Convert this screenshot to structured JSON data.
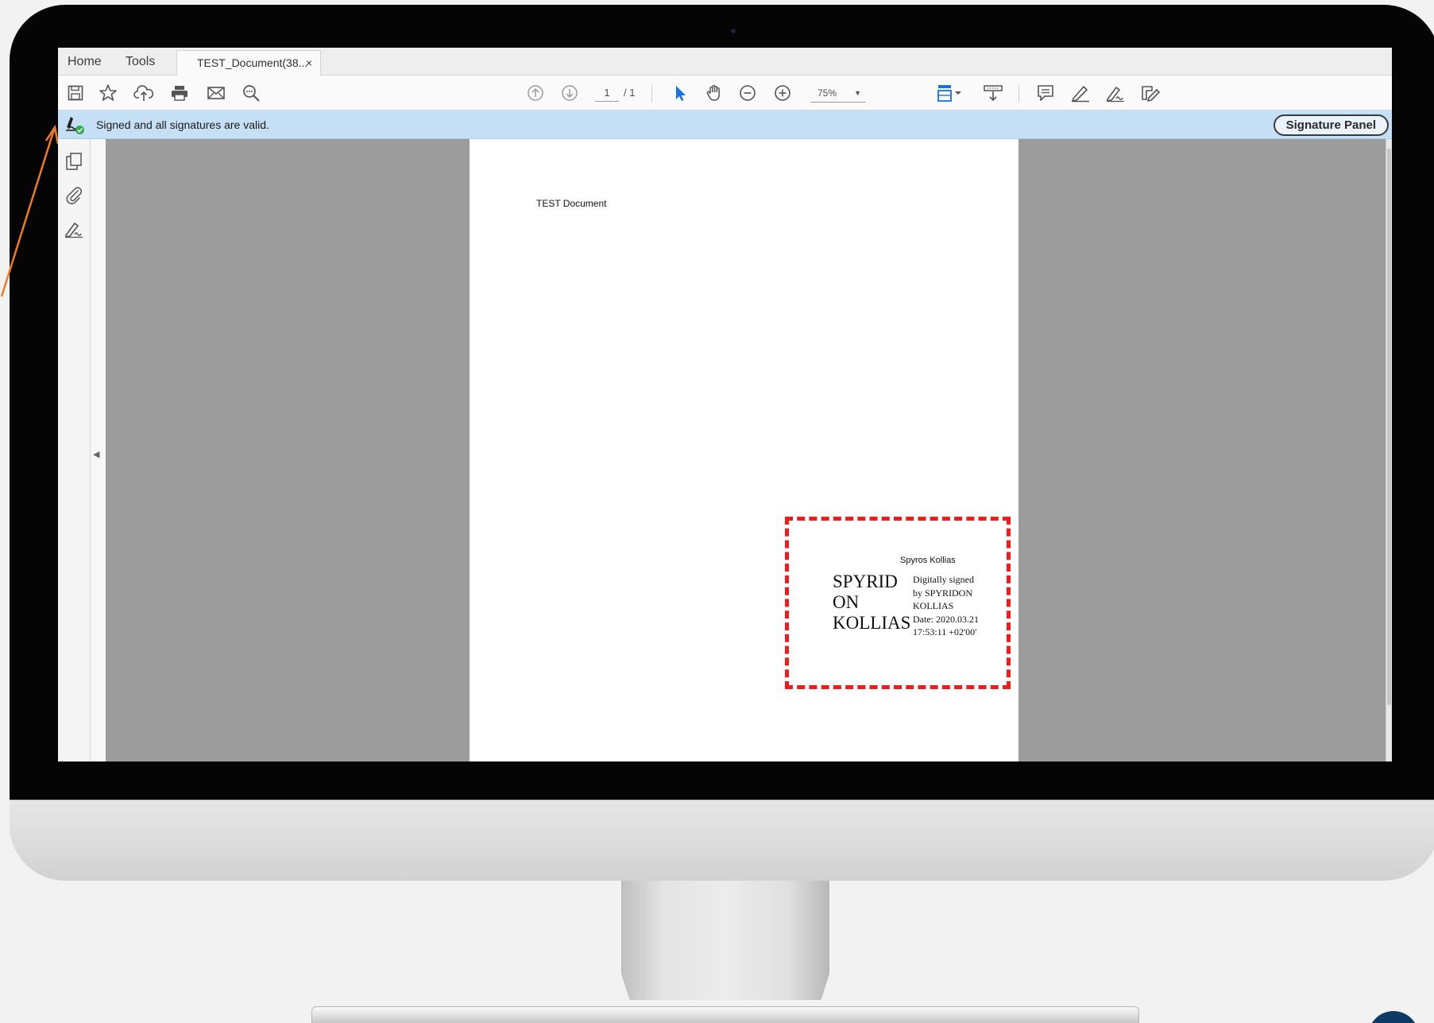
{
  "app": {
    "tabs": {
      "home": "Home",
      "tools": "Tools",
      "document": "TEST_Document(38...",
      "close_symbol": "×"
    },
    "toolbar": {
      "page_current": "1",
      "page_total": "/ 1",
      "zoom": "75%",
      "tools_left": [
        "save-icon",
        "bookmark-star-icon",
        "cloud-upload-icon",
        "print-icon",
        "email-icon",
        "search-zoom-icon"
      ],
      "tools_center": [
        "page-up-icon",
        "page-down-icon",
        "select-arrow-icon",
        "hand-pan-icon",
        "zoom-out-icon",
        "zoom-in-icon",
        "page-display-icon",
        "scroll-mode-icon"
      ],
      "tools_right": [
        "comment-icon",
        "highlight-pen-icon",
        "fill-sign-icon",
        "edit-pdf-icon"
      ]
    },
    "signature_bar": {
      "message": "Signed and all signatures are valid.",
      "panel_button": "Signature Panel",
      "status_color": "#2eaa4f"
    },
    "left_rail": [
      "page-thumbnails-icon",
      "attachments-icon",
      "signatures-icon"
    ],
    "accent_color": "#1473e6"
  },
  "document": {
    "title": "TEST Document",
    "signature": {
      "signer_label": "Spyros Kollias",
      "name_lines": [
        "SPYRID",
        "ON",
        "KOLLIAS"
      ],
      "details": [
        "Digitally signed",
        "by SPYRIDON",
        "KOLLIAS",
        "Date: 2020.03.21",
        "17:53:11 +02'00'"
      ],
      "border_color": "#ee1c1c"
    }
  }
}
